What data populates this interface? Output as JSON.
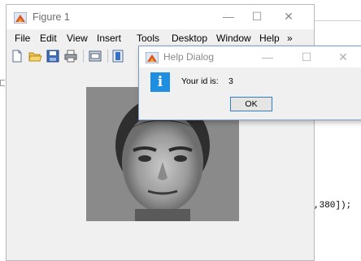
{
  "figure": {
    "title": "Figure 1",
    "menu": [
      "File",
      "Edit",
      "View",
      "Insert",
      "Tools",
      "Desktop",
      "Window",
      "Help"
    ],
    "menu_overflow": "»",
    "window_controls": {
      "minimize": "—",
      "maximize": "☐",
      "close": "✕"
    }
  },
  "editor": {
    "code_fragment": ",380]);"
  },
  "dialog": {
    "title": "Help Dialog",
    "message_label": "Your id is:",
    "message_value": "3",
    "ok_label": "OK",
    "info_glyph": "i",
    "window_controls": {
      "minimize": "—",
      "maximize": "☐",
      "close": "✕"
    }
  },
  "colors": {
    "info_blue": "#1e8fe0",
    "ok_border": "#2f7dd1",
    "window_bg": "#f0f0f0"
  }
}
